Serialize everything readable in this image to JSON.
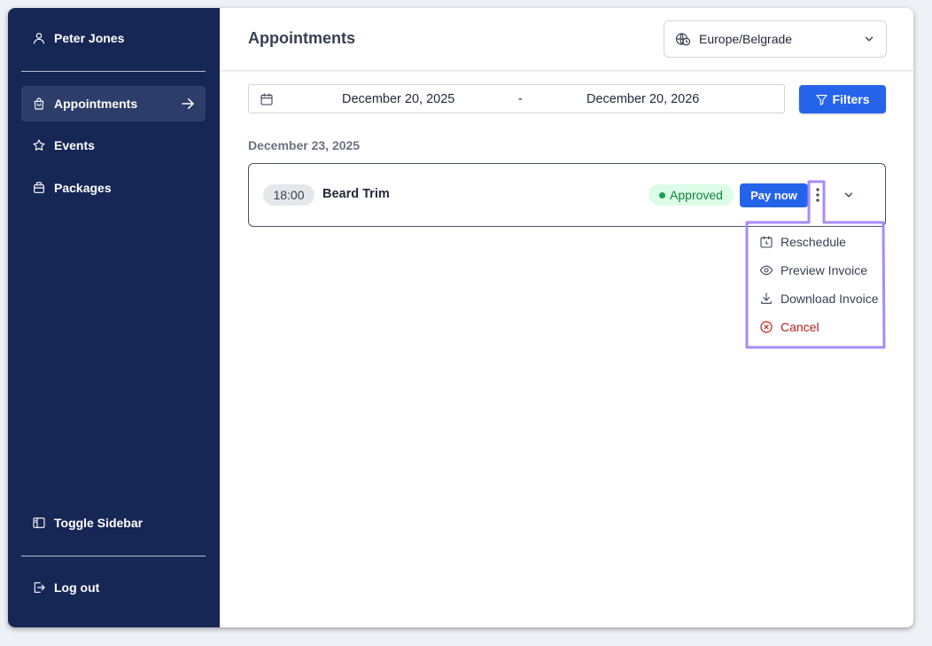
{
  "sidebar": {
    "user_name": "Peter Jones",
    "items": [
      {
        "label": "Appointments",
        "icon": "shopping-bag-icon",
        "active": true
      },
      {
        "label": "Events",
        "icon": "star-icon"
      },
      {
        "label": "Packages",
        "icon": "package-icon"
      }
    ],
    "toggle_label": "Toggle Sidebar",
    "logout_label": "Log out"
  },
  "header": {
    "title": "Appointments",
    "timezone": "Europe/Belgrade"
  },
  "date_range": {
    "start": "December 20, 2025",
    "separator": "-",
    "end": "December 20, 2026"
  },
  "filters_label": "Filters",
  "groups": [
    {
      "date": "December 23, 2025",
      "appointments": [
        {
          "time": "18:00",
          "service": "Beard Trim",
          "status": "Approved",
          "pay_label": "Pay now"
        }
      ]
    }
  ],
  "menu": {
    "items": [
      {
        "label": "Reschedule",
        "icon": "calendar-clock-icon"
      },
      {
        "label": "Preview Invoice",
        "icon": "eye-icon"
      },
      {
        "label": "Download Invoice",
        "icon": "download-icon"
      },
      {
        "label": "Cancel",
        "icon": "x-circle-icon"
      }
    ]
  },
  "colors": {
    "sidebar_bg": "#172755",
    "accent": "#2563eb",
    "success": "#16a34a",
    "danger": "#b91c1c",
    "highlight": "#a78bfa"
  }
}
